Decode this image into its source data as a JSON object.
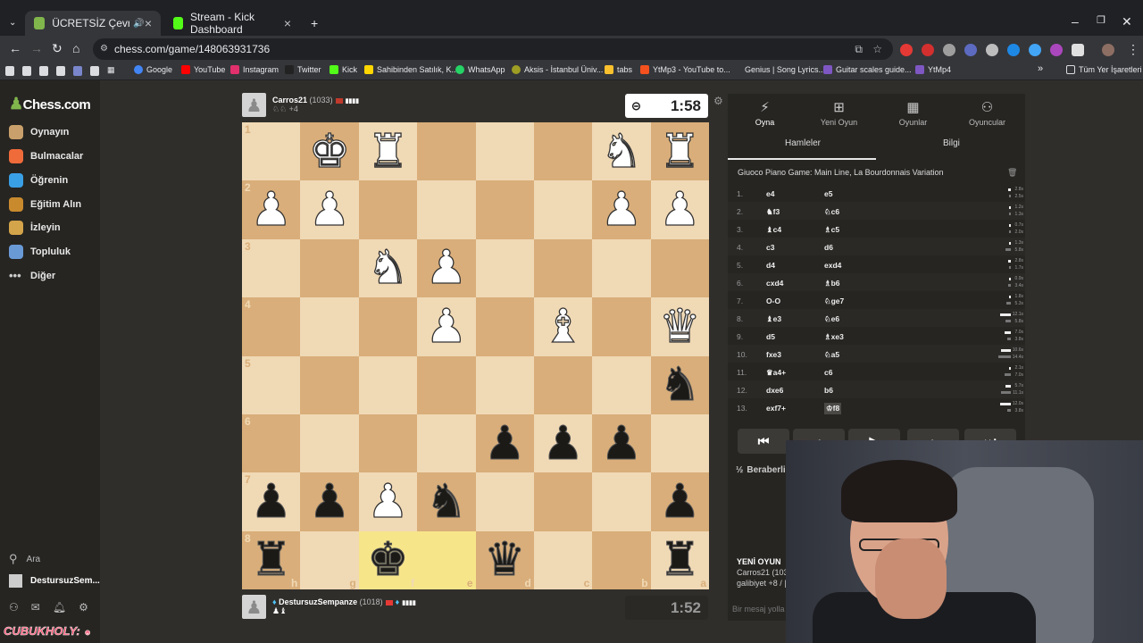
{
  "browser": {
    "tabs": [
      {
        "title": "ÜCRETSİZ Çevrimiçi Satranç",
        "color": "#81b64c"
      },
      {
        "title": "Stream - Kick Dashboard",
        "color": "#53fc18"
      }
    ],
    "url": "chess.com/game/148063931736",
    "bookmarks": [
      "Google",
      "YouTube",
      "Instagram",
      "Twitter",
      "Kick",
      "Sahibinden Satılık, K...",
      "WhatsApp",
      "Aksis - İstanbul Üniv...",
      "tabs",
      "YtMp3 - YouTube to...",
      "Genius | Song Lyrics...",
      "Guitar scales guide...",
      "YtMp4"
    ],
    "all_bookmarks": "Tüm Yer İşaretleri"
  },
  "sidebar": {
    "logo": "Chess.com",
    "items": [
      {
        "label": "Oynayın",
        "icon": "play-icon"
      },
      {
        "label": "Bulmacalar",
        "icon": "puzzle-icon"
      },
      {
        "label": "Öğrenin",
        "icon": "learn-icon"
      },
      {
        "label": "Eğitim Alın",
        "icon": "train-icon"
      },
      {
        "label": "İzleyin",
        "icon": "watch-icon"
      },
      {
        "label": "Topluluk",
        "icon": "community-icon"
      },
      {
        "label": "Diğer",
        "icon": "more-icon"
      }
    ],
    "search_label": "Ara",
    "user_label": "DestursuzSem..."
  },
  "top_player": {
    "name": "Carros21",
    "rating": "(1033)",
    "captured_extra": "+4",
    "clock": "1:58"
  },
  "bottom_player": {
    "name": "DestursuzSempanze",
    "rating": "(1018)",
    "clock": "1:52"
  },
  "board": {
    "ranks": [
      "1",
      "2",
      "3",
      "4",
      "5",
      "6",
      "7",
      "8"
    ],
    "files": [
      "h",
      "g",
      "f",
      "e",
      "d",
      "c",
      "b",
      "a"
    ],
    "rows": [
      [
        "",
        "wK",
        "wR",
        "",
        "",
        "",
        "wN",
        "wR"
      ],
      [
        "wP",
        "wP",
        "",
        "",
        "",
        "",
        "wP",
        "wP"
      ],
      [
        "",
        "",
        "wN",
        "wP",
        "",
        "",
        "",
        ""
      ],
      [
        "",
        "",
        "",
        "wP",
        "",
        "wB",
        "",
        "wQ"
      ],
      [
        "",
        "",
        "",
        "",
        "",
        "",
        "",
        "bN"
      ],
      [
        "",
        "",
        "",
        "",
        "bP",
        "bP",
        "bP",
        ""
      ],
      [
        "bP",
        "bP",
        "wP",
        "bN",
        "",
        "",
        "",
        "bP"
      ],
      [
        "bR",
        "",
        "bK",
        "",
        "bQ",
        "",
        "",
        "bR"
      ]
    ],
    "highlight": [
      [
        7,
        2
      ],
      [
        7,
        3
      ]
    ]
  },
  "panel": {
    "tabs": [
      "Oyna",
      "Yeni Oyun",
      "Oyunlar",
      "Oyuncular"
    ],
    "subtabs": [
      "Hamleler",
      "Bilgi"
    ],
    "opening": "Giuoco Piano Game: Main Line, La Bourdonnais Variation",
    "moves": [
      {
        "n": "1.",
        "w": "e4",
        "b": "e5",
        "wt": "2.8s",
        "bt": "2.5s"
      },
      {
        "n": "2.",
        "w": "♞f3",
        "b": "♘c6",
        "wt": "1.2s",
        "bt": "1.3s"
      },
      {
        "n": "3.",
        "w": "♝c4",
        "b": "♗c5",
        "wt": "0.7s",
        "bt": "2.0s"
      },
      {
        "n": "4.",
        "w": "c3",
        "b": "d6",
        "wt": "1.3s",
        "bt": "5.8s"
      },
      {
        "n": "5.",
        "w": "d4",
        "b": "exd4",
        "wt": "2.8s",
        "bt": "1.7s"
      },
      {
        "n": "6.",
        "w": "cxd4",
        "b": "♗b6",
        "wt": "0.9s",
        "bt": "3.4s"
      },
      {
        "n": "7.",
        "w": "O-O",
        "b": "♘ge7",
        "wt": "1.8s",
        "bt": "5.3s"
      },
      {
        "n": "8.",
        "w": "♝e3",
        "b": "♘e6",
        "wt": "12.1s",
        "bt": "5.8s"
      },
      {
        "n": "9.",
        "w": "d5",
        "b": "♗xe3",
        "wt": "7.0s",
        "bt": "3.8s"
      },
      {
        "n": "10.",
        "w": "fxe3",
        "b": "♘a5",
        "wt": "10.6s",
        "bt": "14.4s"
      },
      {
        "n": "11.",
        "w": "♛a4+",
        "b": "c6",
        "wt": "2.1s",
        "bt": "7.0s"
      },
      {
        "n": "12.",
        "w": "dxe6",
        "b": "b6",
        "wt": "5.7s",
        "bt": "11.1s"
      },
      {
        "n": "13.",
        "w": "exf7+",
        "b": "♔f8",
        "wt": "12.0s",
        "bt": "3.8s"
      }
    ],
    "draw_label": "Beraberli",
    "new_game_label": "YENİ OYUN",
    "chat_lines": [
      "Carros21 (103",
      "galibiyet +8 / |"
    ],
    "chat_placeholder": "Bir mesaj yolla"
  },
  "overlay": {
    "streamer_tag": "CUBUKHOLY:"
  }
}
